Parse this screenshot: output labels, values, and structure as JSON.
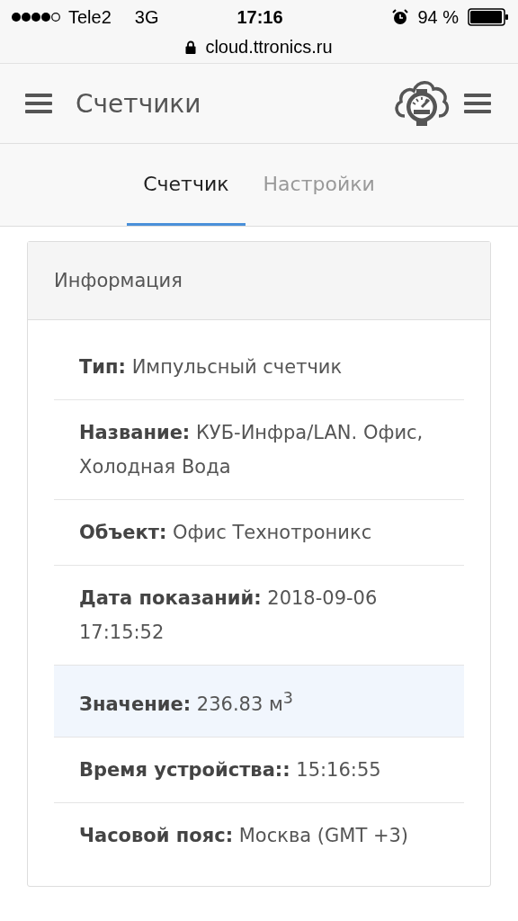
{
  "status_bar": {
    "carrier": "Tele2",
    "network": "3G",
    "time": "17:16",
    "battery": "94 %"
  },
  "address_bar": {
    "url": "cloud.ttronics.ru"
  },
  "header": {
    "title": "Счетчики"
  },
  "tabs": [
    {
      "label": "Счетчик",
      "selected": true
    },
    {
      "label": "Настройки",
      "selected": false
    }
  ],
  "panel": {
    "title": "Информация",
    "rows": [
      {
        "text": "**Тип:** Импульсный счетчик",
        "highlighted": false
      },
      {
        "text": "**Название:** КУБ-Инфра/LAN. Офис, Холодная Вода",
        "highlighted": false
      },
      {
        "text": "**Объект:** Офис Технотроникс",
        "highlighted": false
      },
      {
        "text": "**Дата показаний:** 2018-09-06 17:15:52",
        "highlighted": false
      },
      {
        "text": "**Значение:** 236.83 м$^{3}$",
        "highlighted": true
      },
      {
        "text": "**Время устройства::** 15:16:55",
        "highlighted": false
      },
      {
        "text": "**Часовой пояс:** Москва (GMT +3)",
        "highlighted": false
      }
    ]
  }
}
